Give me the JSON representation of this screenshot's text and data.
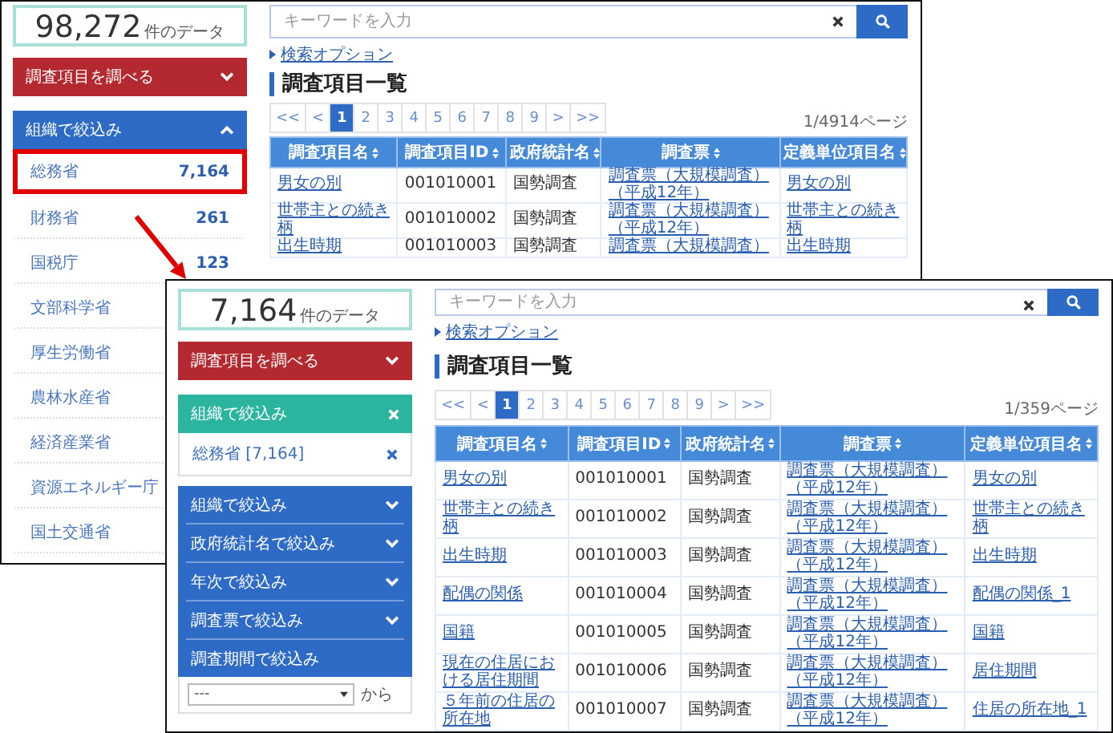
{
  "back_screen": {
    "count": "98,272",
    "count_unit": "件のデータ",
    "menu_button": {
      "label": "調査項目を調べる",
      "expanded": false
    },
    "filter_panel": {
      "title": "組織で絞込み",
      "expanded": true,
      "items": [
        {
          "name": "総務省",
          "count": "7,164",
          "highlighted": true
        },
        {
          "name": "財務省",
          "count": "261",
          "highlighted": false
        },
        {
          "name": "国税庁",
          "count": "123",
          "highlighted": false
        },
        {
          "name": "文部科学省",
          "highlighted": false
        },
        {
          "name": "厚生労働省",
          "highlighted": false
        },
        {
          "name": "農林水産省",
          "highlighted": false
        },
        {
          "name": "経済産業省",
          "highlighted": false
        },
        {
          "name": "資源エネルギー庁",
          "highlighted": false
        },
        {
          "name": "国土交通省",
          "highlighted": false
        }
      ]
    },
    "search": {
      "placeholder": "キーワードを入力"
    },
    "search_option": "検索オプション",
    "title": "調査項目一覧",
    "pagination": {
      "pages": [
        {
          "label": "<<",
          "selected": false
        },
        {
          "label": "<",
          "selected": false
        },
        {
          "label": "1",
          "selected": true
        },
        {
          "label": "2",
          "selected": false
        },
        {
          "label": "3",
          "selected": false
        },
        {
          "label": "4",
          "selected": false
        },
        {
          "label": "5",
          "selected": false
        },
        {
          "label": "6",
          "selected": false
        },
        {
          "label": "7",
          "selected": false
        },
        {
          "label": "8",
          "selected": false
        },
        {
          "label": "9",
          "selected": false
        },
        {
          "label": ">",
          "selected": false
        },
        {
          "label": ">>",
          "selected": false
        }
      ],
      "page_info": "1/4914ページ"
    },
    "table": {
      "columns": [
        {
          "label": "調査項目名",
          "kind": "link"
        },
        {
          "label": "調査項目ID",
          "kind": "text"
        },
        {
          "label": "政府統計名",
          "kind": "text"
        },
        {
          "label": "調査票",
          "kind": "link"
        },
        {
          "label": "定義単位項目名",
          "kind": "link"
        }
      ],
      "rows": [
        [
          "男女の別",
          "001010001",
          "国勢調査",
          "調査票（大規模調査）（平成12年）",
          "男女の別"
        ],
        [
          "世帯主との続き柄",
          "001010002",
          "国勢調査",
          "調査票（大規模調査）（平成12年）",
          "世帯主との続き柄"
        ],
        [
          "出生時期",
          "001010003",
          "国勢調査",
          "調査票（大規模調査）",
          "出生時期"
        ]
      ]
    }
  },
  "front_screen": {
    "count": "7,164",
    "count_unit": "件のデータ",
    "menu_button": {
      "label": "調査項目を調べる",
      "expanded": false
    },
    "active_filter": {
      "title": "組織で絞込み",
      "values": [
        {
          "label": "総務省 [7,164]"
        }
      ]
    },
    "filter_groups": [
      {
        "label": "組織で絞込み",
        "kind": "accordion",
        "expanded": false
      },
      {
        "label": "政府統計名で絞込み",
        "kind": "accordion",
        "expanded": false
      },
      {
        "label": "年次で絞込み",
        "kind": "accordion",
        "expanded": false
      },
      {
        "label": "調査票で絞込み",
        "kind": "accordion",
        "expanded": false
      },
      {
        "label": "調査期間で絞込み",
        "kind": "range"
      }
    ],
    "period_from": {
      "value": "---",
      "suffix": "から"
    },
    "search": {
      "placeholder": "キーワードを入力"
    },
    "search_option": "検索オプション",
    "title": "調査項目一覧",
    "pagination": {
      "pages": [
        {
          "label": "<<",
          "selected": false
        },
        {
          "label": "<",
          "selected": false
        },
        {
          "label": "1",
          "selected": true
        },
        {
          "label": "2",
          "selected": false
        },
        {
          "label": "3",
          "selected": false
        },
        {
          "label": "4",
          "selected": false
        },
        {
          "label": "5",
          "selected": false
        },
        {
          "label": "6",
          "selected": false
        },
        {
          "label": "7",
          "selected": false
        },
        {
          "label": "8",
          "selected": false
        },
        {
          "label": "9",
          "selected": false
        },
        {
          "label": ">",
          "selected": false
        },
        {
          "label": ">>",
          "selected": false
        }
      ],
      "page_info": "1/359ページ"
    },
    "table": {
      "columns": [
        {
          "label": "調査項目名",
          "kind": "link"
        },
        {
          "label": "調査項目ID",
          "kind": "text"
        },
        {
          "label": "政府統計名",
          "kind": "text"
        },
        {
          "label": "調査票",
          "kind": "link"
        },
        {
          "label": "定義単位項目名",
          "kind": "link"
        }
      ],
      "rows": [
        [
          "男女の別",
          "001010001",
          "国勢調査",
          "調査票（大規模調査）（平成12年）",
          "男女の別"
        ],
        [
          "世帯主との続き柄",
          "001010002",
          "国勢調査",
          "調査票（大規模調査）（平成12年）",
          "世帯主との続き柄"
        ],
        [
          "出生時期",
          "001010003",
          "国勢調査",
          "調査票（大規模調査）（平成12年）",
          "出生時期"
        ],
        [
          "配偶の関係",
          "001010004",
          "国勢調査",
          "調査票（大規模調査）（平成12年）",
          "配偶の関係_1"
        ],
        [
          "国籍",
          "001010005",
          "国勢調査",
          "調査票（大規模調査）（平成12年）",
          "国籍"
        ],
        [
          "現在の住居における居住期間",
          "001010006",
          "国勢調査",
          "調査票（大規模調査）（平成12年）",
          "居住期間"
        ],
        [
          "５年前の住居の所在地",
          "001010007",
          "国勢調査",
          "調査票（大規模調査）（平成12年）",
          "住居の所在地_1"
        ]
      ]
    }
  }
}
